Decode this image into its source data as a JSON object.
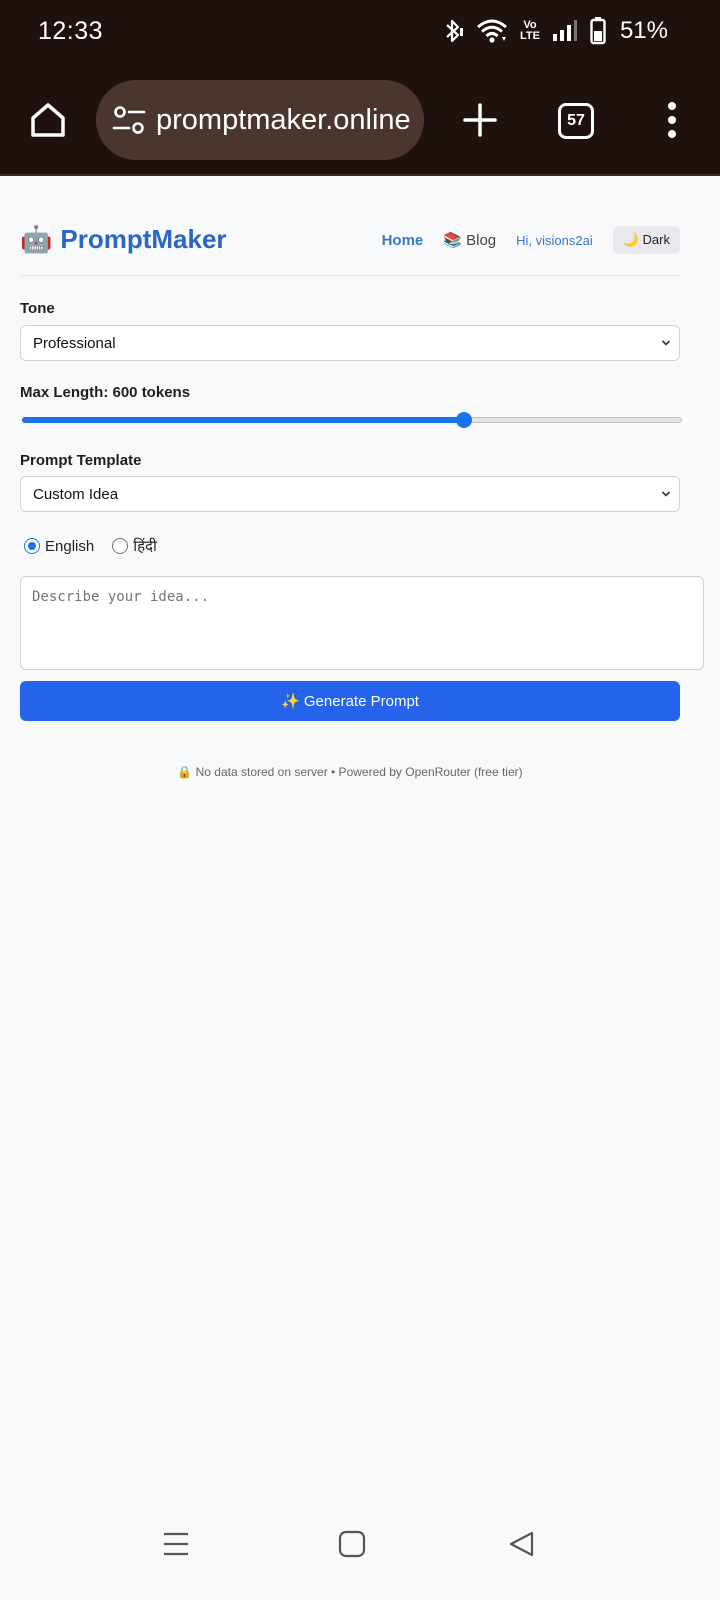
{
  "status_bar": {
    "time": "12:33",
    "volte": "Vo\nLTE",
    "battery_percent": "51%"
  },
  "browser": {
    "url": "promptmaker.online",
    "tab_count": "57",
    "icons": [
      "home-icon",
      "site-settings-icon",
      "plus-icon",
      "tabs-icon",
      "more-vert-icon"
    ]
  },
  "header": {
    "logo_emoji": "🤖",
    "logo_text": "PromptMaker",
    "nav_home": "Home",
    "nav_blog": "📚 Blog",
    "user_greeting": "Hi, visions2ai",
    "theme_button": "🌙 Dark"
  },
  "form": {
    "tone_label": "Tone",
    "tone_value": "Professional",
    "max_length_label": "Max Length: 600 tokens",
    "max_length_fraction": 0.67,
    "template_label": "Prompt Template",
    "template_value": "Custom Idea",
    "language_options": [
      {
        "label": "English",
        "checked": true
      },
      {
        "label": "हिंदी",
        "checked": false
      }
    ],
    "idea_placeholder": "Describe your idea...",
    "generate_button": "✨ Generate Prompt"
  },
  "footer": {
    "note": "🔒 No data stored on server • Powered by OpenRouter (free tier)"
  },
  "colors": {
    "brand": "#2a66c5",
    "primary_button": "#2563eb",
    "chrome_bg": "#1f110e"
  }
}
